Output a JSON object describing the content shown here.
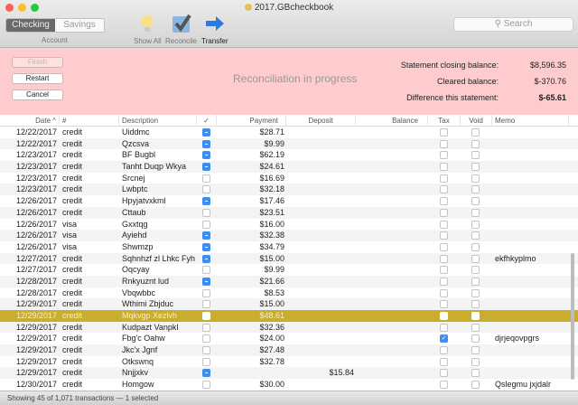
{
  "window": {
    "title": "2017.GBcheckbook"
  },
  "toolbar": {
    "accounts": [
      "Checking",
      "Savings"
    ],
    "account_label": "Account",
    "show_all": "Show All",
    "reconcile": "Reconcile",
    "transfer": "Transfer",
    "search_placeholder": "Search"
  },
  "reconcile": {
    "finish": "Finish",
    "restart": "Restart",
    "cancel": "Cancel",
    "status": "Reconciliation in progress",
    "closing_label": "Statement closing balance:",
    "closing_value": "$8,596.35",
    "cleared_label": "Cleared balance:",
    "cleared_value": "$-370.76",
    "diff_label": "Difference this statement:",
    "diff_value": "$-65.61"
  },
  "columns": {
    "date": "Date ^",
    "num": "#",
    "desc": "Description",
    "check": "✓",
    "payment": "Payment",
    "deposit": "Deposit",
    "balance": "Balance",
    "tax": "Tax",
    "void": "Void",
    "memo": "Memo"
  },
  "rows": [
    {
      "date": "12/22/2017",
      "num": "credit",
      "desc": "Uiddmc",
      "rec": "minus",
      "payment": "$28.71",
      "deposit": "",
      "tax": false,
      "memo": ""
    },
    {
      "date": "12/22/2017",
      "num": "credit",
      "desc": "Qzcsva",
      "rec": "minus",
      "payment": "$9.99",
      "deposit": "",
      "tax": false,
      "memo": ""
    },
    {
      "date": "12/23/2017",
      "num": "credit",
      "desc": "BF Bugbl",
      "rec": "minus",
      "payment": "$62.19",
      "deposit": "",
      "tax": false,
      "memo": ""
    },
    {
      "date": "12/23/2017",
      "num": "credit",
      "desc": "Tanht Duqp Wkya",
      "rec": "minus",
      "payment": "$24.61",
      "deposit": "",
      "tax": false,
      "memo": ""
    },
    {
      "date": "12/23/2017",
      "num": "credit",
      "desc": "Srcnej",
      "rec": "none",
      "payment": "$16.69",
      "deposit": "",
      "tax": false,
      "memo": ""
    },
    {
      "date": "12/23/2017",
      "num": "credit",
      "desc": "Lwbptc",
      "rec": "none",
      "payment": "$32.18",
      "deposit": "",
      "tax": false,
      "memo": ""
    },
    {
      "date": "12/26/2017",
      "num": "credit",
      "desc": "Hpyjatvxkml",
      "rec": "minus",
      "payment": "$17.46",
      "deposit": "",
      "tax": false,
      "memo": ""
    },
    {
      "date": "12/26/2017",
      "num": "credit",
      "desc": "Cttaub",
      "rec": "none",
      "payment": "$23.51",
      "deposit": "",
      "tax": false,
      "memo": ""
    },
    {
      "date": "12/26/2017",
      "num": "visa",
      "desc": "Gxxtqg",
      "rec": "none",
      "payment": "$16.00",
      "deposit": "",
      "tax": false,
      "memo": ""
    },
    {
      "date": "12/26/2017",
      "num": "visa",
      "desc": "Ayiehd",
      "rec": "minus",
      "payment": "$32.38",
      "deposit": "",
      "tax": false,
      "memo": ""
    },
    {
      "date": "12/26/2017",
      "num": "visa",
      "desc": "Shwmzp",
      "rec": "minus",
      "payment": "$34.79",
      "deposit": "",
      "tax": false,
      "memo": ""
    },
    {
      "date": "12/27/2017",
      "num": "credit",
      "desc": "Sqhnhzf zl Lhkc Fyh",
      "rec": "minus",
      "payment": "$15.00",
      "deposit": "",
      "tax": false,
      "memo": "ekfhkyplmo"
    },
    {
      "date": "12/27/2017",
      "num": "credit",
      "desc": "Oqcyay",
      "rec": "none",
      "payment": "$9.99",
      "deposit": "",
      "tax": false,
      "memo": ""
    },
    {
      "date": "12/28/2017",
      "num": "credit",
      "desc": "Rnkyuznt lud",
      "rec": "minus",
      "payment": "$21.66",
      "deposit": "",
      "tax": false,
      "memo": ""
    },
    {
      "date": "12/28/2017",
      "num": "credit",
      "desc": "Vbqwbbc",
      "rec": "none",
      "payment": "$8.53",
      "deposit": "",
      "tax": false,
      "memo": ""
    },
    {
      "date": "12/29/2017",
      "num": "credit",
      "desc": "Wthimi Zbjduc",
      "rec": "none",
      "payment": "$15.00",
      "deposit": "",
      "tax": false,
      "memo": ""
    },
    {
      "date": "12/29/2017",
      "num": "credit",
      "desc": "Mqkvgp Xezlvh",
      "rec": "none",
      "payment": "$48.61",
      "deposit": "",
      "tax": false,
      "memo": "",
      "selected": true
    },
    {
      "date": "12/29/2017",
      "num": "credit",
      "desc": "Kudpazt Vanpkl",
      "rec": "none",
      "payment": "$32.36",
      "deposit": "",
      "tax": false,
      "memo": ""
    },
    {
      "date": "12/29/2017",
      "num": "credit",
      "desc": "Fbg'c Oahw",
      "rec": "none",
      "payment": "$24.00",
      "deposit": "",
      "tax": true,
      "memo": "djrjeqovpgrs"
    },
    {
      "date": "12/29/2017",
      "num": "credit",
      "desc": "Jkc'x Jgnf",
      "rec": "none",
      "payment": "$27.48",
      "deposit": "",
      "tax": false,
      "memo": ""
    },
    {
      "date": "12/29/2017",
      "num": "credit",
      "desc": "Otkswnq",
      "rec": "none",
      "payment": "$32.78",
      "deposit": "",
      "tax": false,
      "memo": ""
    },
    {
      "date": "12/29/2017",
      "num": "credit",
      "desc": "Nnjjxkv",
      "rec": "minus",
      "payment": "",
      "deposit": "$15.84",
      "tax": false,
      "memo": ""
    },
    {
      "date": "12/30/2017",
      "num": "credit",
      "desc": "Homgow",
      "rec": "none",
      "payment": "$30.00",
      "deposit": "",
      "tax": false,
      "memo": "Qslegmu jxjdalr"
    }
  ],
  "status": "Showing 45 of 1,071 transactions — 1 selected"
}
